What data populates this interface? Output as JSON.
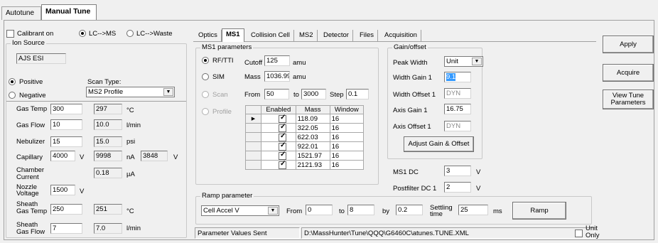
{
  "top_tabs": [
    "Autotune",
    "Manual Tune"
  ],
  "calibrant": {
    "label": "Calibrant on",
    "checked": false
  },
  "lc_ms": {
    "label": "LC-->MS",
    "selected": true
  },
  "lc_waste": {
    "label": "LC-->Waste",
    "selected": false
  },
  "ion_source": {
    "title": "Ion Source",
    "source_name": "AJS ESI",
    "positive_label": "Positive",
    "negative_label": "Negative",
    "scan_type_label": "Scan Type:",
    "scan_type_value": "MS2 Profile",
    "rows": {
      "gas_temp": {
        "label": "Gas Temp",
        "set": "300",
        "actual": "297",
        "unit": "°C"
      },
      "gas_flow": {
        "label": "Gas Flow",
        "set": "10",
        "actual": "10.0",
        "unit": "l/min"
      },
      "nebulizer": {
        "label": "Nebulizer",
        "set": "15",
        "actual": "15.0",
        "unit": "psi"
      },
      "capillary": {
        "label": "Capillary",
        "set": "4000",
        "set_unit": "V",
        "actual": "9998",
        "unit": "nA",
        "extra": "3848",
        "extra_unit": "V"
      },
      "chamber": {
        "label1": "Chamber",
        "label2": "Current",
        "actual": "0.18",
        "unit": "µA"
      },
      "nozzle": {
        "label1": "Nozzle",
        "label2": "Voltage",
        "set": "1500",
        "unit": "V"
      },
      "sheath_temp": {
        "label1": "Sheath",
        "label2": "Gas Temp",
        "set": "250",
        "actual": "251",
        "unit": "°C"
      },
      "sheath_flow": {
        "label1": "Sheath",
        "label2": "Gas Flow",
        "set": "7",
        "actual": "7.0",
        "unit": "l/min"
      }
    }
  },
  "sub_tabs": [
    "Optics",
    "MS1",
    "Collision Cell",
    "MS2",
    "Detector",
    "Files",
    "Acquisition"
  ],
  "ms1_params": {
    "title": "MS1 parameters",
    "rf_tti": {
      "label": "RF/TTI",
      "cutoff_label": "Cutoff",
      "cutoff": "125",
      "unit": "amu"
    },
    "sim": {
      "label": "SIM",
      "mass_label": "Mass",
      "mass": "1036.99",
      "unit": "amu"
    },
    "scan": {
      "label": "Scan",
      "from_label": "From",
      "from": "50",
      "to_label": "to",
      "to": "3000",
      "step_label": "Step",
      "step": "0.1"
    },
    "profile": {
      "label": "Profile"
    },
    "table_headers": [
      "Enabled",
      "Mass",
      "Window"
    ],
    "table_rows": [
      {
        "mass": "118.09",
        "window": "16"
      },
      {
        "mass": "322.05",
        "window": "16"
      },
      {
        "mass": "622.03",
        "window": "16"
      },
      {
        "mass": "922.01",
        "window": "16"
      },
      {
        "mass": "1521.97",
        "window": "16"
      },
      {
        "mass": "2121.93",
        "window": "16"
      }
    ]
  },
  "gain_offset": {
    "title": "Gain/offset",
    "peak_width_label": "Peak Width",
    "peak_width": "Unit",
    "width_gain_label": "Width Gain 1",
    "width_gain": "9.1",
    "width_offset_label": "Width Offset 1",
    "width_offset": "DYN",
    "axis_gain_label": "Axis Gain 1",
    "axis_gain": "16.75",
    "axis_offset_label": "Axis Offset 1",
    "axis_offset": "DYN",
    "adjust_button": "Adjust Gain & Offset"
  },
  "ms1_dc": {
    "label": "MS1 DC",
    "value": "3",
    "unit": "V"
  },
  "postfilter": {
    "label": "Postfilter DC 1",
    "value": "2",
    "unit": "V"
  },
  "ramp": {
    "title": "Ramp parameter",
    "param": "Cell Accel V",
    "from_label": "From",
    "from": "0",
    "to_label": "to",
    "to": "8",
    "by_label": "by",
    "by": "0.2",
    "settling_label1": "Settling",
    "settling_label2": "time",
    "settling": "25",
    "settling_unit": "ms",
    "button": "Ramp"
  },
  "status": {
    "message": "Parameter Values Sent",
    "path": "D:\\MassHunter\\Tune\\QQQ\\G6460C\\atunes.TUNE.XML",
    "unit_only_label1": "Unit",
    "unit_only_label2": "Only"
  },
  "side_buttons": {
    "apply": "Apply",
    "acquire": "Acquire",
    "view_tune1": "View Tune",
    "view_tune2": "Parameters"
  }
}
